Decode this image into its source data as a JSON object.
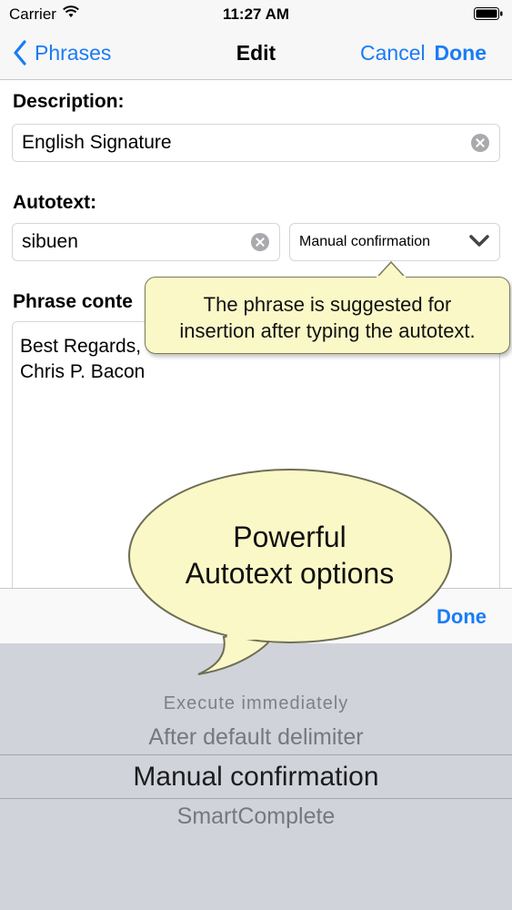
{
  "status_bar": {
    "carrier": "Carrier",
    "time": "11:27 AM"
  },
  "nav": {
    "back_label": "Phrases",
    "title": "Edit",
    "cancel_label": "Cancel",
    "done_label": "Done"
  },
  "description": {
    "label": "Description:",
    "value": "English Signature"
  },
  "autotext": {
    "label": "Autotext:",
    "value": "sibuen",
    "mode_selected": "Manual confirmation"
  },
  "phrase_content": {
    "label": "Phrase conte",
    "lines": [
      "Best Regards,",
      "Chris P. Bacon"
    ]
  },
  "tooltip": {
    "line1": "The phrase is suggested for",
    "line2": "insertion after typing the autotext."
  },
  "promo_bubble": {
    "line1": "Powerful",
    "line2": "Autotext options"
  },
  "toolbar": {
    "done_label": "Done"
  },
  "picker": {
    "options": [
      "Execute immediately",
      "After default delimiter",
      "Manual confirmation",
      "SmartComplete"
    ],
    "selected": "Manual confirmation"
  },
  "colors": {
    "accent": "#1a7cf4",
    "callout_fill": "#fbf8c7",
    "picker_bg": "#d0d3d9"
  },
  "icons": [
    "wifi-icon",
    "battery-icon",
    "back-chevron-icon",
    "clear-icon",
    "chevron-down-icon"
  ]
}
